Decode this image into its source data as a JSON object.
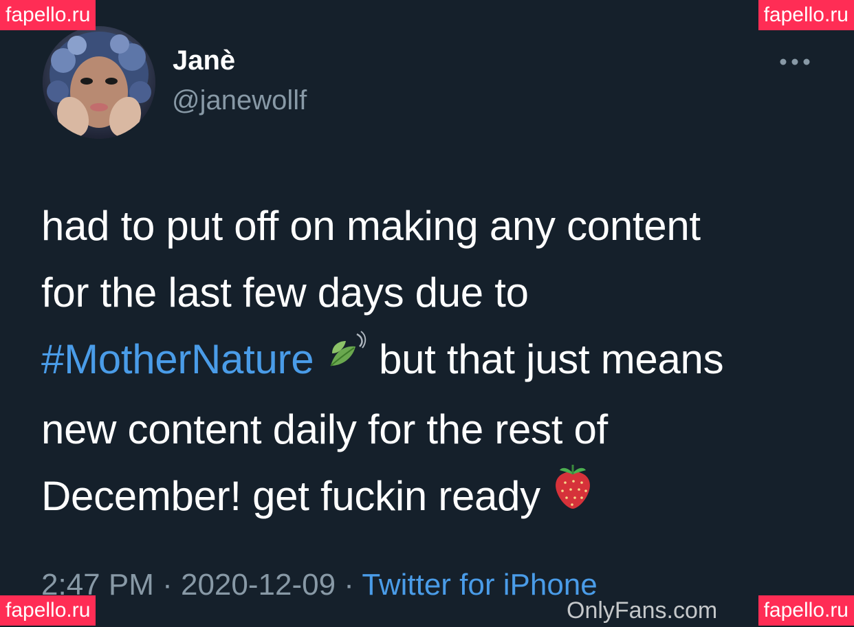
{
  "user": {
    "display_name": "Janè",
    "handle": "@janewollf"
  },
  "tweet": {
    "line1": "had to put off on making any content",
    "line2": "for the last few days due to",
    "hashtag": "#MotherNature",
    "line3_rest": " but that just means",
    "line4": "new content daily for the rest of",
    "line5": "December! get fuckin ready "
  },
  "meta": {
    "time": "2:47 PM",
    "separator1": " · ",
    "date": "2020-12-09",
    "separator2": " · ",
    "source": "Twitter for iPhone"
  },
  "watermarks": {
    "top_left": "fapello.ru",
    "top_right": "fapello.ru",
    "bottom_left": "fapello.ru",
    "bottom_right": "fapello.ru",
    "onlyfans": "OnlyFans.com"
  },
  "icons": {
    "more": "more-horizontal-icon",
    "leaf_emoji": "leaf-fluttering-in-wind-emoji",
    "strawberry_emoji": "strawberry-emoji"
  },
  "colors": {
    "background": "#15202b",
    "link": "#4a9ce8",
    "secondary_text": "#8899a6",
    "watermark": "#ff2d55"
  }
}
